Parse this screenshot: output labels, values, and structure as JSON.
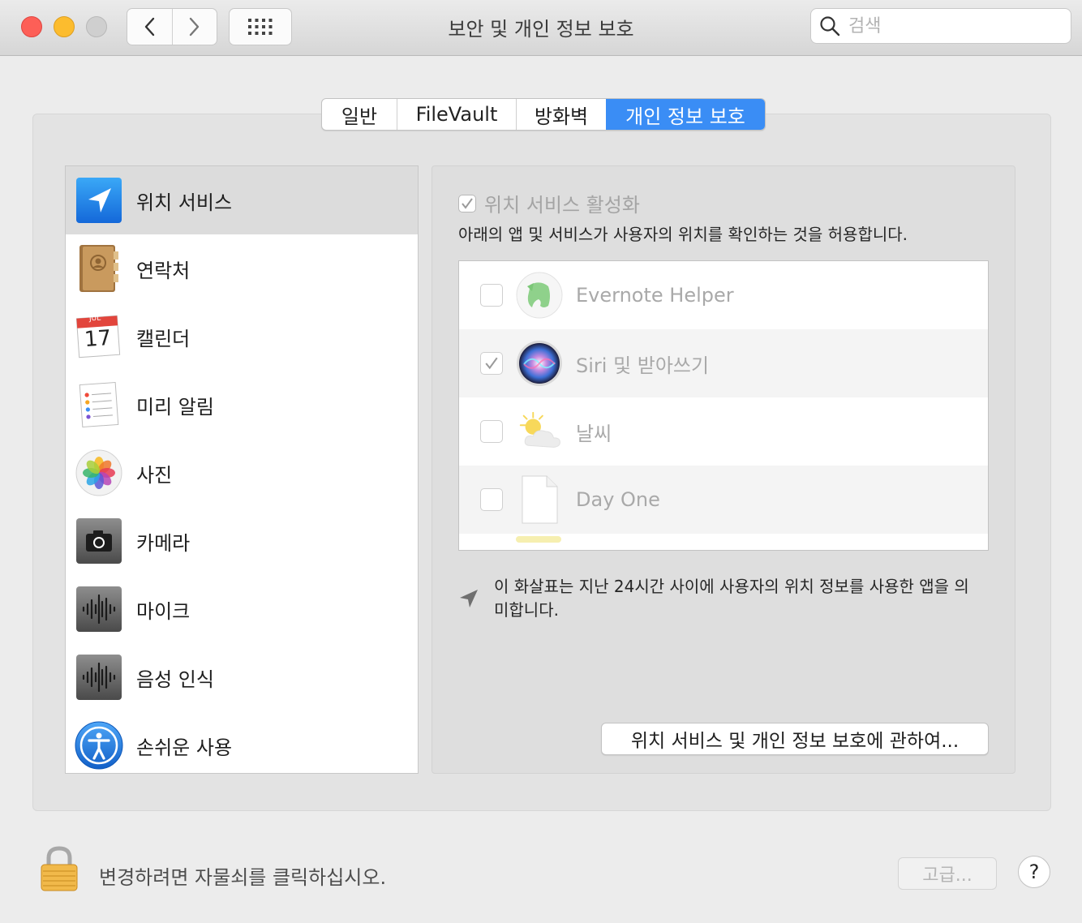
{
  "window": {
    "title": "보안 및 개인 정보 보호",
    "search_placeholder": "검색"
  },
  "tabs": [
    {
      "label": "일반",
      "selected": false
    },
    {
      "label": "FileVault",
      "selected": false
    },
    {
      "label": "방화벽",
      "selected": false
    },
    {
      "label": "개인 정보 보호",
      "selected": true
    }
  ],
  "sidebar": {
    "items": [
      {
        "label": "위치 서비스",
        "icon": "location-arrow-icon",
        "selected": true
      },
      {
        "label": "연락처",
        "icon": "contacts-book-icon"
      },
      {
        "label": "캘린더",
        "icon": "calendar-icon",
        "calendar_month": "JUL",
        "calendar_day": "17"
      },
      {
        "label": "미리 알림",
        "icon": "reminders-icon"
      },
      {
        "label": "사진",
        "icon": "photos-icon"
      },
      {
        "label": "카메라",
        "icon": "camera-icon"
      },
      {
        "label": "마이크",
        "icon": "microphone-waveform-icon"
      },
      {
        "label": "음성 인식",
        "icon": "speech-recognition-icon"
      },
      {
        "label": "손쉬운 사용",
        "icon": "accessibility-icon"
      }
    ]
  },
  "location": {
    "enable_label": "위치 서비스 활성화",
    "enable_checked": true,
    "description": "아래의 앱 및 서비스가 사용자의 위치를 확인하는 것을 허용합니다.",
    "apps": [
      {
        "name": "Evernote Helper",
        "checked": false,
        "icon": "evernote-elephant-icon"
      },
      {
        "name": "Siri 및 받아쓰기",
        "checked": true,
        "icon": "siri-icon"
      },
      {
        "name": "날씨",
        "checked": false,
        "icon": "weather-sun-cloud-icon"
      },
      {
        "name": "Day One",
        "checked": false,
        "icon": "blank-document-icon"
      }
    ],
    "note": "이 화살표는 지난 24시간 사이에 사용자의 위치 정보를 사용한 앱을 의미합니다.",
    "about_button": "위치 서비스 및 개인 정보 보호에 관하여..."
  },
  "footer": {
    "lock_text": "변경하려면 자물쇠를 클릭하십시오.",
    "advanced_button": "고급...",
    "help_button": "?"
  },
  "colors": {
    "accent": "#3a8df5",
    "close": "#fd5f57",
    "minimize": "#fcbc2e"
  }
}
